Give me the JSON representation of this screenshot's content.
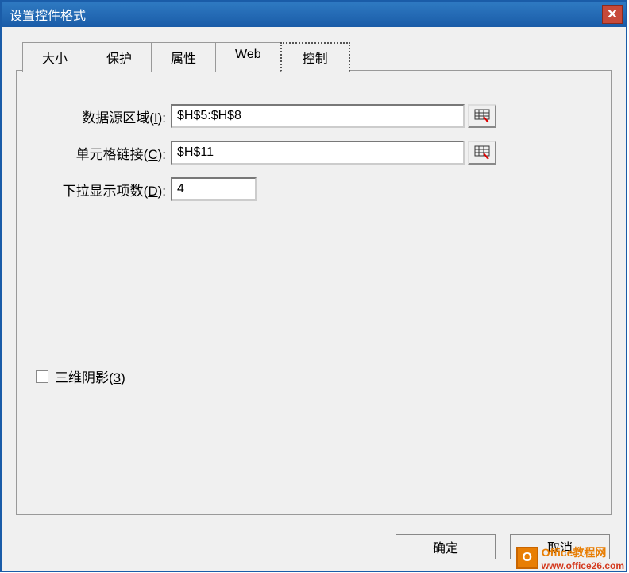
{
  "window": {
    "title": "设置控件格式"
  },
  "tabs": {
    "items": [
      {
        "label": "大小"
      },
      {
        "label": "保护"
      },
      {
        "label": "属性"
      },
      {
        "label": "Web"
      },
      {
        "label": "控制"
      }
    ],
    "active": 4
  },
  "form": {
    "data_source_label_pre": "数据源区域(",
    "data_source_key": "I",
    "data_source_label_post": "):",
    "data_source_value": "$H$5:$H$8",
    "cell_link_label_pre": "单元格链接(",
    "cell_link_key": "C",
    "cell_link_label_post": "):",
    "cell_link_value": "$H$11",
    "dropdown_lines_label_pre": "下拉显示项数(",
    "dropdown_lines_key": "D",
    "dropdown_lines_label_post": "):",
    "dropdown_lines_value": "4",
    "shadow_label_pre": "三维阴影(",
    "shadow_key": "3",
    "shadow_label_post": ")"
  },
  "buttons": {
    "ok": "确定",
    "cancel": "取消"
  },
  "watermark": {
    "line1": "Office教程网",
    "line2": "www.office26.com",
    "logo": "O"
  }
}
